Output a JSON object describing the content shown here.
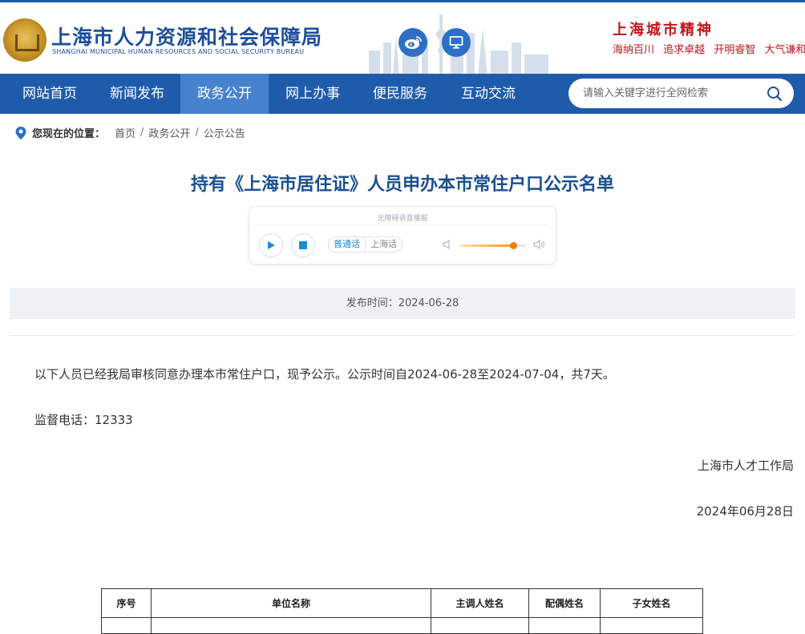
{
  "header": {
    "site_title": "上海市人力资源和社会保障局",
    "site_subtitle": "SHANGHAI MUNICIPAL HUMAN RESOURCES AND SOCIAL SECURITY BUREAU",
    "spirit_title": "上海城市精神",
    "spirit_items": [
      "海纳百川",
      "追求卓越",
      "开明睿智",
      "大气谦和"
    ]
  },
  "nav": {
    "items": [
      {
        "label": "网站首页",
        "active": false
      },
      {
        "label": "新闻发布",
        "active": false
      },
      {
        "label": "政务公开",
        "active": true
      },
      {
        "label": "网上办事",
        "active": false
      },
      {
        "label": "便民服务",
        "active": false
      },
      {
        "label": "互动交流",
        "active": false
      }
    ],
    "search_placeholder": "请输入关键字进行全网检索",
    "active_color": "#4782cf",
    "bar_color": "#1f5bab"
  },
  "breadcrumb": {
    "label": "您现在的位置：",
    "items": [
      "首页",
      "政务公开",
      "公示公告"
    ]
  },
  "article": {
    "title": "持有《上海市居住证》人员申办本市常住户口公示名单",
    "player": {
      "title": "无障碍语音播报",
      "lang_mandarin": "普通话",
      "lang_shanghai": "上海话",
      "volume": 0.8
    },
    "publish_time": "发布时间：2024-06-28",
    "body": "以下人员已经我局审核同意办理本市常住户口，现予公示。公示时间自2024-06-28至2024-07-04，共7天。",
    "phone": "监督电话：12333",
    "signer": "上海市人才工作局",
    "date": "2024年06月28日"
  },
  "table": {
    "headers": [
      "序号",
      "单位名称",
      "主调人姓名",
      "配偶姓名",
      "子女姓名"
    ]
  }
}
